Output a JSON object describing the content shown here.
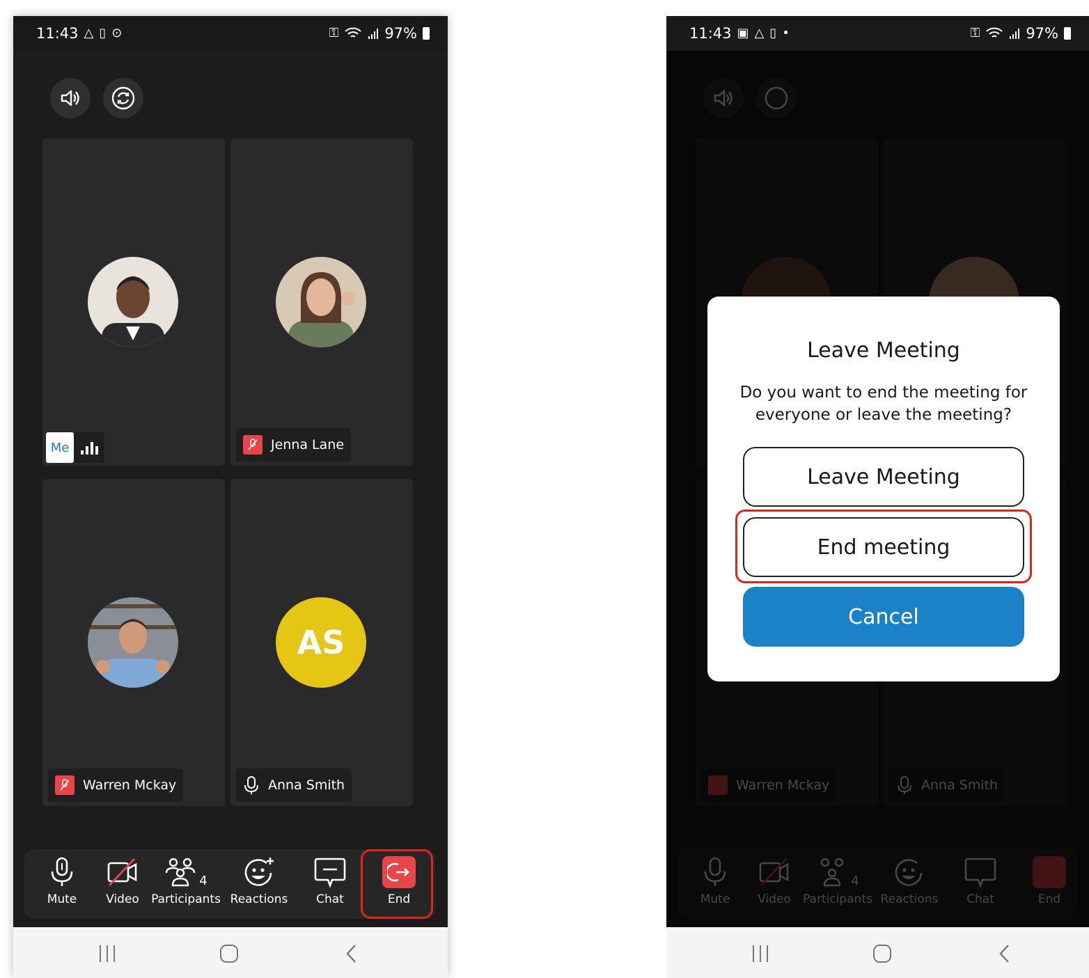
{
  "status": {
    "time": "11:43",
    "battery": "97%"
  },
  "tiles": [
    {
      "type": "photo",
      "tag": "Me",
      "skin": "#6b4530",
      "bg": "#e8e4dc",
      "shirt": "#2b2b2e"
    },
    {
      "type": "photo",
      "name": "Jenna Lane",
      "muted": true,
      "skin": "#e3b79c",
      "bg": "#d8c9b4",
      "shirt": "#6a7a5c"
    },
    {
      "type": "photo",
      "name": "Warren Mckay",
      "muted": true,
      "skin": "#d09a7a",
      "bg": "#8a8e96",
      "shirt": "#7fa8d6"
    },
    {
      "type": "initials",
      "name": "Anna Smith",
      "initials": "AS",
      "muted": false
    }
  ],
  "toolbar": {
    "mute": "Mute",
    "video": "Video",
    "participants": "Participants",
    "participants_count": "4",
    "reactions": "Reactions",
    "chat": "Chat",
    "end": "End"
  },
  "dialog": {
    "title": "Leave Meeting",
    "message": "Do you want to end the meeting for everyone or leave the meeting?",
    "leave_label": "Leave Meeting",
    "end_label": "End meeting",
    "cancel_label": "Cancel"
  },
  "colors": {
    "end_red": "#e8454a",
    "cancel_blue": "#1c82c8",
    "highlight": "#e0251c",
    "avatar_yellow": "#e6c615"
  }
}
